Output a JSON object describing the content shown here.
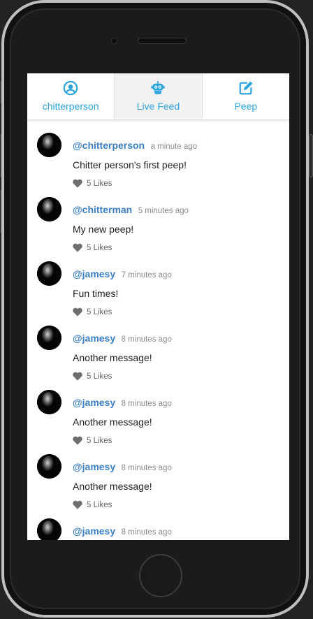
{
  "nav": {
    "tabs": [
      {
        "label": "chitterperson",
        "icon": "user-circle-icon",
        "active": false
      },
      {
        "label": "Live Feed",
        "icon": "robot-icon",
        "active": true
      },
      {
        "label": "Peep",
        "icon": "edit-icon",
        "active": false
      }
    ]
  },
  "feed": {
    "peeps": [
      {
        "handle": "@chitterperson",
        "time": "a minute ago",
        "text": "Chitter person's first peep!",
        "likes": "5 Likes"
      },
      {
        "handle": "@chitterman",
        "time": "5 minutes ago",
        "text": "My new peep!",
        "likes": "5 Likes"
      },
      {
        "handle": "@jamesy",
        "time": "7 minutes ago",
        "text": "Fun times!",
        "likes": "5 Likes"
      },
      {
        "handle": "@jamesy",
        "time": "8 minutes ago",
        "text": "Another message!",
        "likes": "5 Likes"
      },
      {
        "handle": "@jamesy",
        "time": "8 minutes ago",
        "text": "Another message!",
        "likes": "5 Likes"
      },
      {
        "handle": "@jamesy",
        "time": "8 minutes ago",
        "text": "Another message!",
        "likes": "5 Likes"
      },
      {
        "handle": "@jamesy",
        "time": "8 minutes ago",
        "text": "",
        "likes": ""
      }
    ]
  },
  "colors": {
    "accent": "#2ba4dd",
    "handle": "#3b7fc4",
    "timestamp": "#8a8a8a"
  }
}
